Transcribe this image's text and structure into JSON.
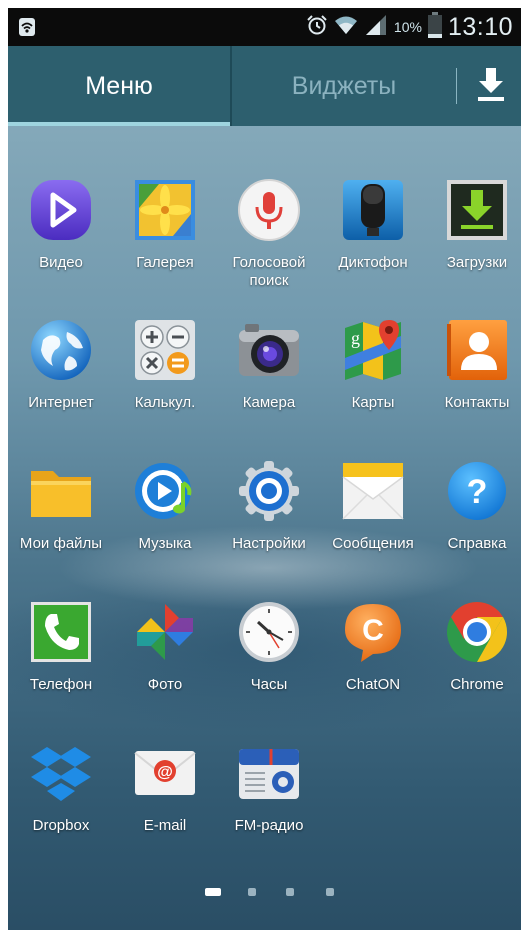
{
  "status_bar": {
    "battery_percent": "10%",
    "time": "13:10",
    "icons": [
      "wifi-settings-icon",
      "alarm-icon",
      "wifi-icon",
      "signal-icon",
      "battery-icon"
    ]
  },
  "tabs": {
    "menu_label": "Меню",
    "widgets_label": "Виджеты",
    "download_icon": "download-icon"
  },
  "apps": [
    {
      "label": "Видео",
      "icon": "video-icon"
    },
    {
      "label": "Галерея",
      "icon": "gallery-icon"
    },
    {
      "label": "Голосовой\nпоиск",
      "icon": "voice-search-icon"
    },
    {
      "label": "Диктофон",
      "icon": "recorder-icon"
    },
    {
      "label": "Загрузки",
      "icon": "downloads-icon"
    },
    {
      "label": "Интернет",
      "icon": "internet-icon"
    },
    {
      "label": "Калькул.",
      "icon": "calculator-icon"
    },
    {
      "label": "Камера",
      "icon": "camera-icon"
    },
    {
      "label": "Карты",
      "icon": "maps-icon"
    },
    {
      "label": "Контакты",
      "icon": "contacts-icon"
    },
    {
      "label": "Мои файлы",
      "icon": "my-files-icon"
    },
    {
      "label": "Музыка",
      "icon": "music-icon"
    },
    {
      "label": "Настройки",
      "icon": "settings-icon"
    },
    {
      "label": "Сообщения",
      "icon": "messages-icon"
    },
    {
      "label": "Справка",
      "icon": "help-icon"
    },
    {
      "label": "Телефон",
      "icon": "phone-icon"
    },
    {
      "label": "Фото",
      "icon": "photos-icon"
    },
    {
      "label": "Часы",
      "icon": "clock-icon"
    },
    {
      "label": "ChatON",
      "icon": "chaton-icon"
    },
    {
      "label": "Chrome",
      "icon": "chrome-icon"
    },
    {
      "label": "Dropbox",
      "icon": "dropbox-icon"
    },
    {
      "label": "E-mail",
      "icon": "email-icon"
    },
    {
      "label": "FM-радио",
      "icon": "fm-radio-icon"
    }
  ],
  "pager": {
    "pages": 4,
    "current": 1
  }
}
